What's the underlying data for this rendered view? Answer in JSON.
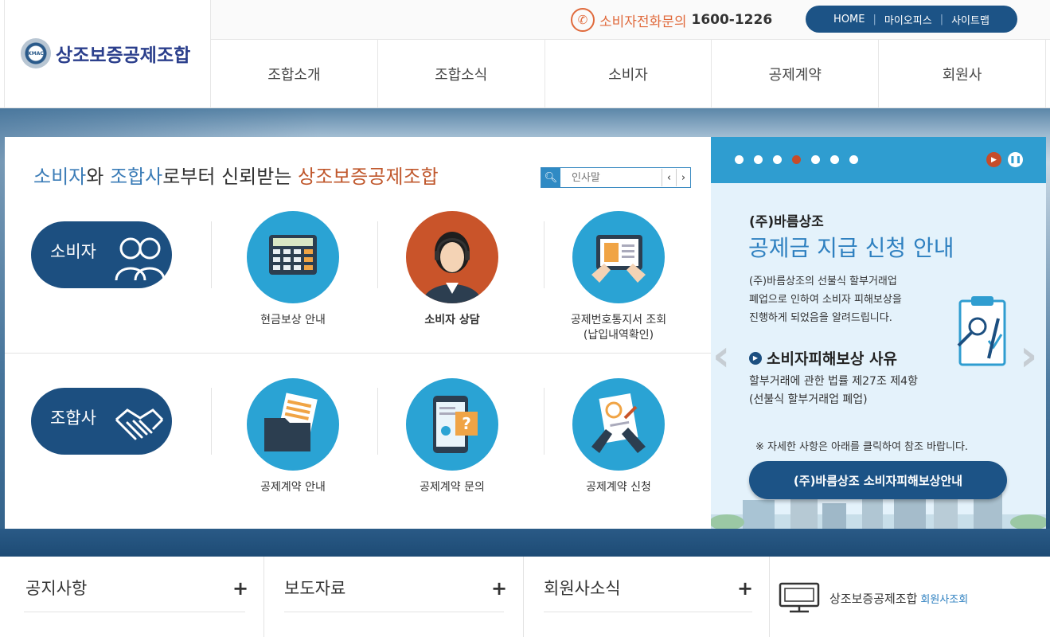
{
  "header": {
    "logo_text": "상조보증공제조합",
    "logo_emblem_text": "KMAC",
    "phone_label": "소비자전화문의",
    "phone_number": "1600-1226",
    "util_links": [
      "HOME",
      "마이오피스",
      "사이트맵"
    ],
    "nav": [
      "조합소개",
      "조합소식",
      "소비자",
      "공제계약",
      "회원사"
    ]
  },
  "main": {
    "tagline": {
      "part1": "소비자",
      "part2": "와 ",
      "part3": "조합사",
      "part4": "로부터 신뢰받는 ",
      "part5": "상조보증공제조합"
    },
    "search": {
      "placeholder": "인사말"
    },
    "consumer_label": "소비자",
    "member_label": "조합사",
    "consumer_services": [
      {
        "label": "현금보상 안내",
        "icon": "calculator-icon"
      },
      {
        "label": "소비자 상담",
        "icon": "counselor-icon"
      },
      {
        "label": "공제번호통지서 조회",
        "sub": "(납입내역확인)",
        "icon": "tablet-document-icon"
      }
    ],
    "member_services": [
      {
        "label": "공제계약 안내",
        "icon": "folder-documents-icon"
      },
      {
        "label": "공제계약 문의",
        "icon": "tablet-question-icon"
      },
      {
        "label": "공제계약 신청",
        "icon": "clipboard-sign-icon"
      }
    ]
  },
  "slider": {
    "dots": 7,
    "active_dot": 4,
    "subtitle": "(주)바름상조",
    "title": "공제금 지급 신청 안내",
    "desc_lines": [
      "(주)바름상조의 선불식 할부거래업",
      "폐업으로 인하여 소비자 피해보상을",
      "진행하게 되었음을 알려드립니다."
    ],
    "reason_head": "소비자피해보상 사유",
    "reason_lines": [
      "할부거래에 관한 법률 제27조 제4항",
      "(선불식 할부거래업 폐업)"
    ],
    "note": "※ 자세한 사항은 아래를 클릭하여 참조 바랍니다.",
    "cta": "(주)바름상조 소비자피해보상안내"
  },
  "bottom": {
    "news": [
      {
        "title": "공지사항"
      },
      {
        "title": "보도자료"
      },
      {
        "title": "회원사소식"
      }
    ],
    "plus": "+",
    "member_lookup_label": "상조보증공제조합",
    "member_lookup_link": "회원사조회"
  },
  "colors": {
    "brand_navy": "#1c5386",
    "accent_orange": "#c64c2a",
    "sky_blue": "#2f9dd0"
  }
}
